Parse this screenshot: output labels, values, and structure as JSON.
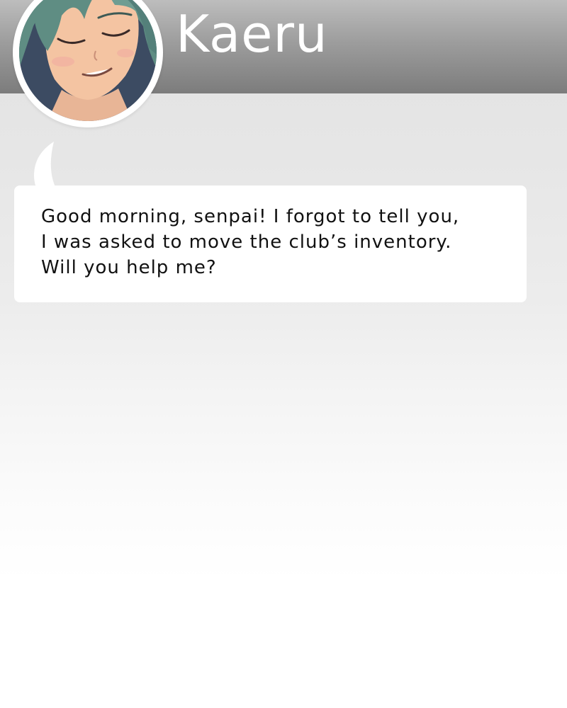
{
  "speaker": {
    "name": "Kaeru",
    "avatar_icon": "character-portrait"
  },
  "dialog": {
    "lines": [
      "Good morning, senpai! I forgot to tell you,",
      "I was asked to move the club’s inventory.",
      "Will you help me?"
    ]
  },
  "colors": {
    "header_top": "#bdbdbd",
    "header_bottom": "#7c7c7c",
    "dialog_background": "#ffffff",
    "text": "#111111",
    "hair": "#5f8d83",
    "skin": "#f4c4a2"
  }
}
